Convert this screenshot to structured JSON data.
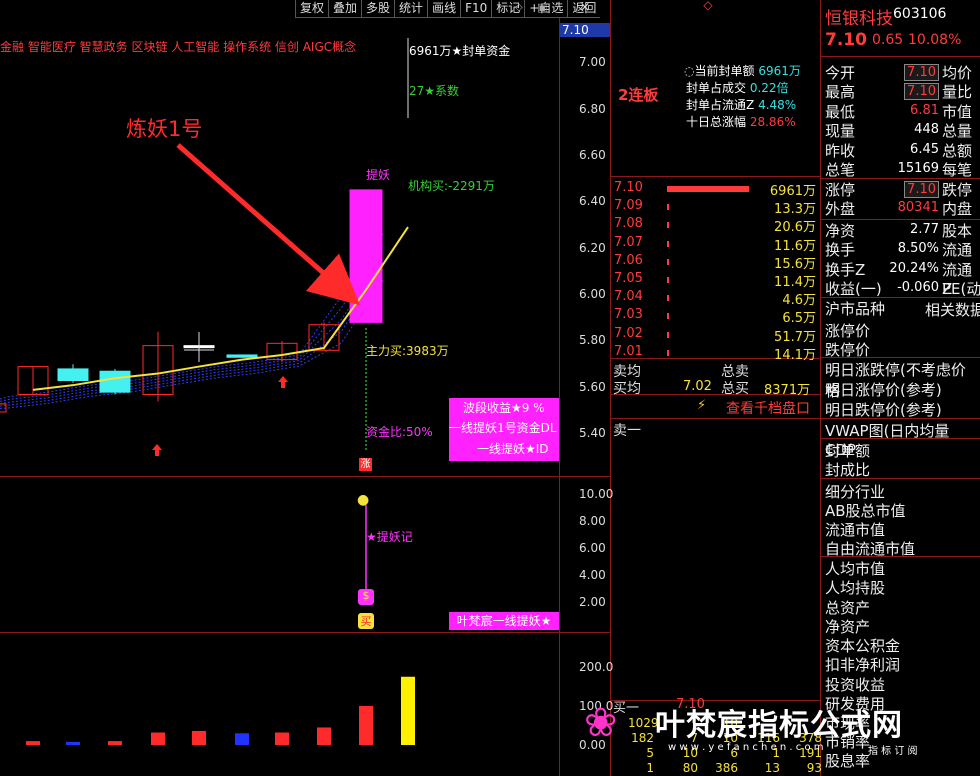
{
  "toolbar": [
    "复权",
    "叠加",
    "多股",
    "统计",
    "画线",
    "F10",
    "标记",
    "+自选",
    "返回"
  ],
  "window_controls": {
    "close": "×",
    "restore": "◇"
  },
  "concepts": "金融 智能医疗 智慧政务 区块链 人工智能 操作系统 信创 AIGC概念",
  "price_axis": [
    "7.00",
    "6.80",
    "6.60",
    "6.40",
    "6.20",
    "6.00",
    "5.80",
    "5.60",
    "5.40"
  ],
  "price_axis_current": "7.10",
  "indicator_axis": [
    "10.00",
    "8.00",
    "6.00",
    "4.00",
    "2.00"
  ],
  "volume_axis": [
    "200.0",
    "100.0",
    "0.00"
  ],
  "annotations": {
    "arrow_label": "炼妖1号",
    "seal_amount": "6961万★封单资金",
    "factor": "27★系数",
    "tiyao": "提妖",
    "inst_buy": "机构买:-2291万",
    "main_buy": "主力买:3983万",
    "fund_ratio": "资金比:50%",
    "band_gain": "波段收益★9 %",
    "line1": "一线提妖1号资金DL",
    "line2": "一线提妖★ID",
    "zhang": "涨",
    "tiyao_ji": "★提妖记",
    "brand_bar": "叶梵宸一线提妖★"
  },
  "seal_info": {
    "lianban": "2连板",
    "rows": [
      {
        "label": "当前封单额",
        "value": "6961万"
      },
      {
        "label": "封单占成交",
        "value": "0.22倍"
      },
      {
        "label": "封单占流通Z",
        "value": "4.48%"
      },
      {
        "label": "十日总涨幅",
        "value": "28.86%"
      }
    ]
  },
  "order_book": {
    "bids": [
      {
        "price": "7.10",
        "vol": "6961万"
      },
      {
        "price": "7.09",
        "vol": "13.3万"
      },
      {
        "price": "7.08",
        "vol": "20.6万"
      },
      {
        "price": "7.07",
        "vol": "11.6万"
      },
      {
        "price": "7.06",
        "vol": "15.6万"
      },
      {
        "price": "7.05",
        "vol": "11.4万"
      },
      {
        "price": "7.04",
        "vol": "4.6万"
      },
      {
        "price": "7.03",
        "vol": "6.5万"
      },
      {
        "price": "7.02",
        "vol": "51.7万"
      },
      {
        "price": "7.01",
        "vol": "14.1万"
      }
    ],
    "sell_avg_label": "卖均",
    "total_sell_label": "总卖",
    "buy_avg_label": "买均",
    "buy_avg": "7.02",
    "total_buy_label": "总买",
    "total_buy": "8371万",
    "depth_link": "查看千档盘口",
    "sell1": "卖一",
    "buy1": "买一",
    "buy1_price": "7.10",
    "trade_rows": [
      [
        "1029",
        "  ",
        "10",
        "  ",
        "  "
      ],
      [
        "182",
        "7",
        "10",
        "116",
        "378"
      ],
      [
        "5",
        "10",
        "6",
        "1",
        "191"
      ],
      [
        "1",
        "80",
        "386",
        "13",
        "93"
      ]
    ]
  },
  "stock": {
    "name": "恒银科技",
    "code": "603106",
    "price": "7.10",
    "change": "0.65",
    "pct": "10.08%"
  },
  "quote": [
    {
      "l": "今开",
      "v": "7.10",
      "l2": "均价"
    },
    {
      "l": "最高",
      "v": "7.10",
      "l2": "量比"
    },
    {
      "l": "最低",
      "v": "6.81",
      "l2": "市值"
    },
    {
      "l": "现量",
      "v": "448",
      "l2": "总量"
    },
    {
      "l": "昨收",
      "v": "6.45",
      "l2": "总额"
    },
    {
      "l": "总笔",
      "v": "15169",
      "l2": "每笔"
    },
    {
      "l": "涨停",
      "v": "7.10",
      "l2": "跌停"
    },
    {
      "l": "外盘",
      "v": "80341",
      "l2": "内盘"
    },
    {
      "l": "净资",
      "v": "2.77",
      "l2": "股本"
    },
    {
      "l": "换手",
      "v": "8.50%",
      "l2": "流通"
    },
    {
      "l": "换手Z",
      "v": "20.24%",
      "l2": "流通Z"
    },
    {
      "l": "收益(一)",
      "v": "-0.060",
      "l2": "PE(动)"
    }
  ],
  "info_list": [
    "沪市品种",
    "涨停价",
    "跌停价",
    "明日涨跌停(不考虑价格",
    "明日涨停价(参考)",
    "明日跌停价(参考)",
    "VWAP图(日内均量 CDP",
    "封单额",
    "封成比",
    "细分行业",
    "AB股总市值",
    "流通市值",
    "自由流通市值",
    "人均市值",
    "人均持股",
    "总资产",
    "净资产",
    "资本公积金",
    "扣非净利润",
    "投资收益",
    "研发费用",
    "市现率",
    "市销率",
    "股息率"
  ],
  "sh_related": "相关数据",
  "watermark": {
    "text": "叶梵宸指标公式网",
    "url": "w w w . y e f a n c h e n . c o m",
    "sub": "指 标 订 阅"
  },
  "chart_data": {
    "type": "bar",
    "candles": [
      {
        "open": 5.57,
        "close": 5.69,
        "high": 5.69,
        "low": 5.57,
        "color": "red"
      },
      {
        "open": 5.68,
        "close": 5.63,
        "high": 5.7,
        "low": 5.62,
        "color": "cyan"
      },
      {
        "open": 5.67,
        "close": 5.58,
        "high": 5.68,
        "low": 5.57,
        "color": "cyan"
      },
      {
        "open": 5.57,
        "close": 5.78,
        "high": 5.84,
        "low": 5.54,
        "color": "red"
      },
      {
        "open": 5.78,
        "close": 5.78,
        "high": 5.82,
        "low": 5.76,
        "color": "white"
      },
      {
        "open": 5.73,
        "close": 5.74,
        "high": 5.74,
        "low": 5.73,
        "color": "cyan"
      },
      {
        "open": 5.72,
        "close": 5.79,
        "high": 5.8,
        "low": 5.71,
        "color": "red"
      },
      {
        "open": 5.76,
        "close": 5.87,
        "high": 5.88,
        "low": 5.76,
        "color": "red"
      },
      {
        "open": 5.88,
        "close": 6.45,
        "high": 6.45,
        "low": 5.88,
        "color": "magenta"
      }
    ],
    "ma": [
      5.59,
      5.61,
      5.64,
      5.66,
      5.69,
      5.72,
      5.74,
      5.77,
      6.02,
      6.29
    ],
    "volume": [
      10,
      8,
      10,
      32,
      36,
      30,
      32,
      45,
      100,
      175
    ],
    "volume_colors": [
      "red",
      "blue",
      "red",
      "red",
      "red",
      "blue",
      "red",
      "red",
      "red",
      "yellow"
    ]
  }
}
